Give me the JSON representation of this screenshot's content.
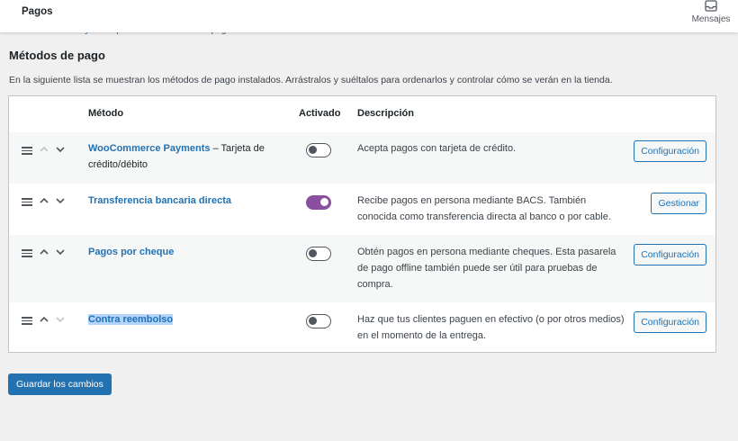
{
  "topbar": {
    "title": "Pagos",
    "messages_label": "Mensajes",
    "messages_icon": "inbox-icon"
  },
  "breadcrumb": {
    "parent": "WooCommerce Payments",
    "separator": "|",
    "current": "Todos los métodos de pago"
  },
  "page": {
    "title": "Métodos de pago",
    "description": "En la siguiente lista se muestran los métodos de pago instalados. Arrástralos y suéltalos para ordenarlos y controlar cómo se verán en la tienda."
  },
  "table": {
    "headers": {
      "method": "Método",
      "enabled": "Activado",
      "description": "Descripción"
    },
    "rows": [
      {
        "name": "WooCommerce Payments",
        "name_suffix": " – Tarjeta de crédito/débito",
        "enabled": false,
        "description": "Acepta pagos con tarjeta de crédito.",
        "action": "Configuración",
        "can_move_up": false,
        "can_move_down": true
      },
      {
        "name": "Transferencia bancaria directa",
        "name_suffix": "",
        "enabled": true,
        "description": "Recibe pagos en persona mediante BACS. También conocida como transferencia directa al banco o por cable.",
        "action": "Gestionar",
        "can_move_up": true,
        "can_move_down": true
      },
      {
        "name": "Pagos por cheque",
        "name_suffix": "",
        "enabled": false,
        "description": "Obtén pagos en persona mediante cheques. Esta pasarela de pago offline también puede ser útil para pruebas de compra.",
        "action": "Configuración",
        "can_move_up": true,
        "can_move_down": true
      },
      {
        "name": "Contra reembolso",
        "name_suffix": "",
        "enabled": false,
        "description": "Haz que tus clientes paguen en efectivo (o por otros medios) en el momento de la entrega.",
        "action": "Configuración",
        "can_move_up": true,
        "can_move_down": false
      }
    ]
  },
  "save_button": "Guardar los cambios",
  "colors": {
    "link": "#2271b1",
    "toggle_on": "#8a4f9e",
    "primary_button": "#2271b1"
  },
  "icons": {
    "drag": "drag-handle-icon",
    "up": "chevron-up-icon",
    "down": "chevron-down-icon"
  }
}
